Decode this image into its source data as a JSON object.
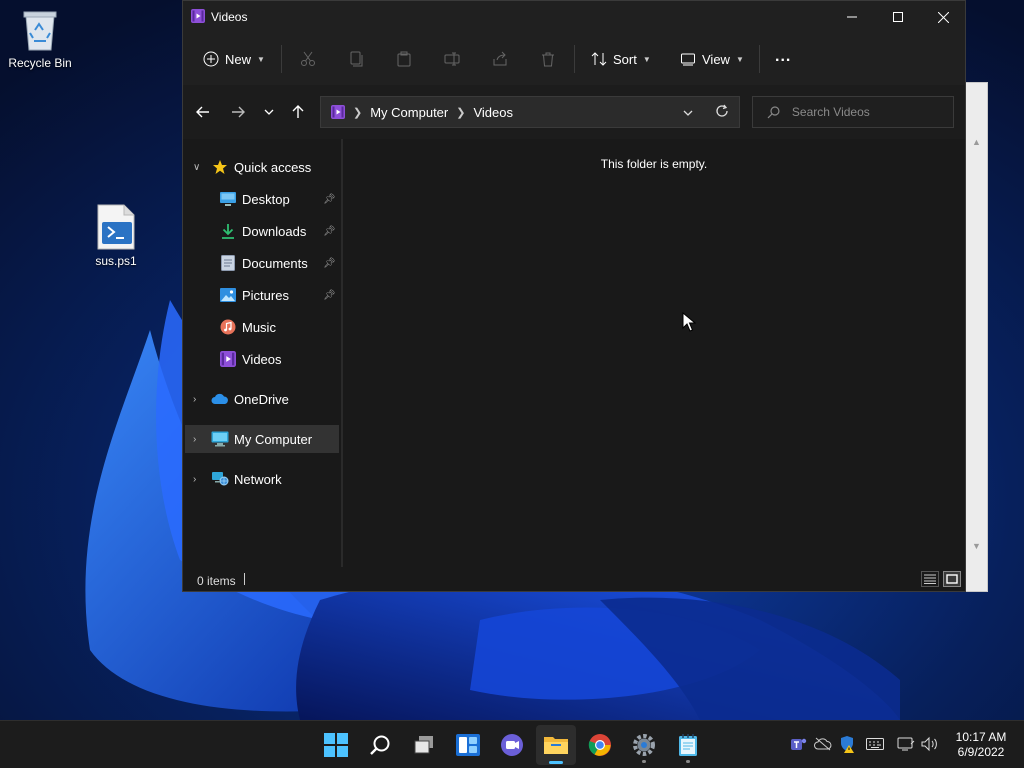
{
  "desktop": {
    "icons": [
      {
        "label": "Recycle Bin",
        "icon": "recycle-bin-icon"
      },
      {
        "label": "sus.ps1",
        "icon": "powershell-script-icon"
      }
    ]
  },
  "window": {
    "title": "Videos",
    "controls": [
      "minimize",
      "maximize",
      "close"
    ]
  },
  "commandbar": {
    "new_label": "New",
    "sort_label": "Sort",
    "view_label": "View",
    "more_label": "...",
    "actions": [
      "cut",
      "copy",
      "paste",
      "rename",
      "share",
      "delete"
    ]
  },
  "navigation": {
    "address": {
      "crumbs": [
        "My Computer",
        "Videos"
      ]
    },
    "search": {
      "placeholder": "Search Videos"
    }
  },
  "sidebar": {
    "quick_access": "Quick access",
    "quick_items": [
      {
        "label": "Desktop",
        "pinned": true
      },
      {
        "label": "Downloads",
        "pinned": true
      },
      {
        "label": "Documents",
        "pinned": true
      },
      {
        "label": "Pictures",
        "pinned": true
      },
      {
        "label": "Music",
        "pinned": false
      },
      {
        "label": "Videos",
        "pinned": false
      }
    ],
    "onedrive": "OneDrive",
    "my_computer": "My Computer",
    "network": "Network",
    "selected": "My Computer"
  },
  "content": {
    "empty_message": "This folder is empty."
  },
  "status": {
    "item_count": "0 items",
    "view_mode": "large-icons"
  },
  "taskbar": {
    "apps": [
      "start",
      "search",
      "task-view",
      "widgets",
      "chat",
      "file-explorer",
      "chrome",
      "settings",
      "notepad"
    ],
    "active_app": "file-explorer",
    "clock": {
      "time": "10:17 AM",
      "date": "6/9/2022"
    }
  },
  "colors": {
    "accent": "#4cc2ff",
    "window_bg": "#191919",
    "titlebar_bg": "#202020",
    "selection_bg": "#333333"
  }
}
